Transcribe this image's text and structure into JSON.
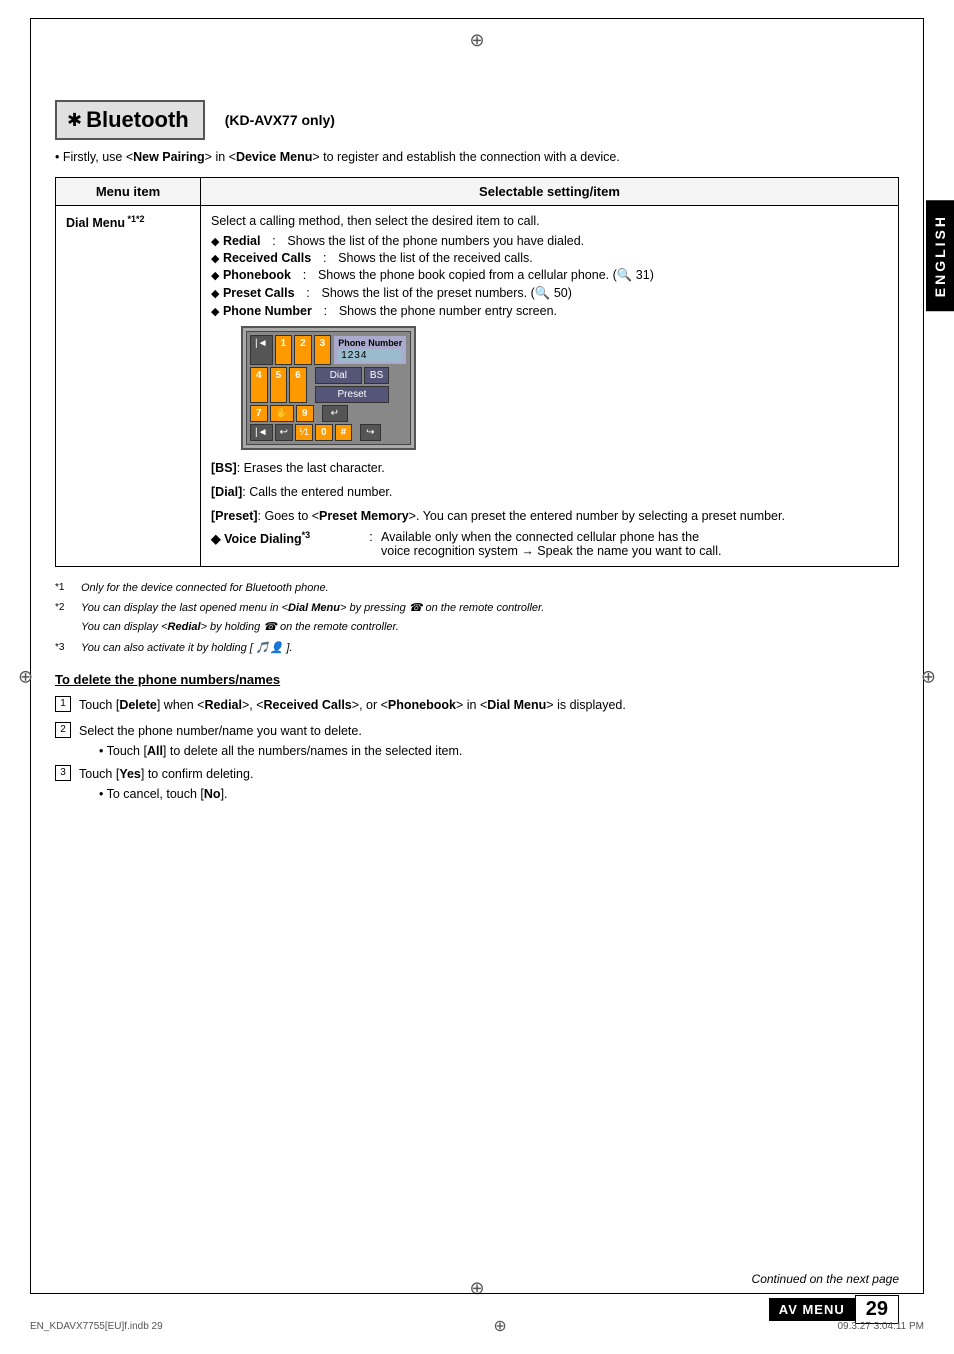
{
  "page": {
    "title": "Bluetooth",
    "subtitle": "(KD-AVX77 only)",
    "intro": "Firstly, use <New Pairing> in <Device Menu> to register and establish the connection with a device.",
    "table": {
      "col1_header": "Menu item",
      "col2_header": "Selectable setting/item",
      "row1": {
        "menu_item": "Dial Menu",
        "superscripts": "*1*2",
        "intro": "Select a calling method, then select the desired item to call.",
        "items": [
          {
            "label": "Redial",
            "desc": "Shows the list of the phone numbers you have dialed."
          },
          {
            "label": "Received Calls",
            "desc": "Shows the list of the received calls."
          },
          {
            "label": "Phonebook",
            "desc": "Shows the phone book copied from a cellular phone. (  31)"
          },
          {
            "label": "Preset Calls",
            "desc": "Shows the list of the preset numbers. (  50)"
          },
          {
            "label": "Phone Number",
            "desc": "Shows the phone number entry screen."
          }
        ],
        "keypad_display": "1234",
        "key_descs": [
          "[BS]: Erases the last character.",
          "[Dial]: Calls the entered number.",
          "[Preset]: Goes to <Preset Memory>. You can preset the entered number by selecting a preset number."
        ],
        "voice": {
          "label": "Voice Dialing",
          "superscript": "*3",
          "desc": "Available only when the connected cellular phone has the voice recognition system → Speak the name you want to call."
        }
      }
    },
    "footnotes": [
      {
        "mark": "*1",
        "text": "Only for the device connected for Bluetooth phone."
      },
      {
        "mark": "*2",
        "text": "You can display the last opened menu in <Dial Menu> by pressing  on the remote controller. You can display <Redial> by holding  on the remote controller."
      },
      {
        "mark": "*3",
        "text": "You can also activate it by holding [  ]."
      }
    ],
    "delete_section": {
      "title": "To delete the phone numbers/names",
      "steps": [
        {
          "num": "1",
          "text": "Touch [Delete] when <Redial>, <Received Calls>, or <Phonebook> in <Dial Menu> is displayed."
        },
        {
          "num": "2",
          "text": "Select the phone number/name you want to delete.",
          "sub": "Touch [All] to delete all the numbers/names in the selected item."
        },
        {
          "num": "3",
          "text": "Touch [Yes] to confirm deleting.",
          "sub": "To cancel, touch [No]."
        }
      ]
    },
    "footer": {
      "file": "EN_KDAVX7755[EU]f.indb   29",
      "date": "09.3.27   3:04:11 PM",
      "continued": "Continued on the next page",
      "av_menu": "AV MENU",
      "page_num": "29"
    },
    "english_tab": "ENGLISH"
  }
}
